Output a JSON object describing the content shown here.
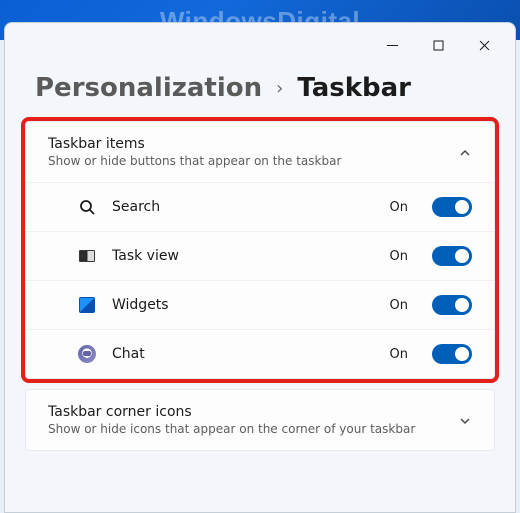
{
  "watermark": "WindowsDigital",
  "breadcrumb": {
    "parent": "Personalization",
    "current": "Taskbar"
  },
  "sections": {
    "taskbar_items": {
      "title": "Taskbar items",
      "subtitle": "Show or hide buttons that appear on the taskbar",
      "expanded": true,
      "rows": [
        {
          "icon": "search-icon",
          "label": "Search",
          "state": "On",
          "on": true
        },
        {
          "icon": "task-view-icon",
          "label": "Task view",
          "state": "On",
          "on": true
        },
        {
          "icon": "widgets-icon",
          "label": "Widgets",
          "state": "On",
          "on": true
        },
        {
          "icon": "chat-icon",
          "label": "Chat",
          "state": "On",
          "on": true
        }
      ]
    },
    "taskbar_corner_icons": {
      "title": "Taskbar corner icons",
      "subtitle": "Show or hide icons that appear on the corner of your taskbar",
      "expanded": false
    }
  }
}
